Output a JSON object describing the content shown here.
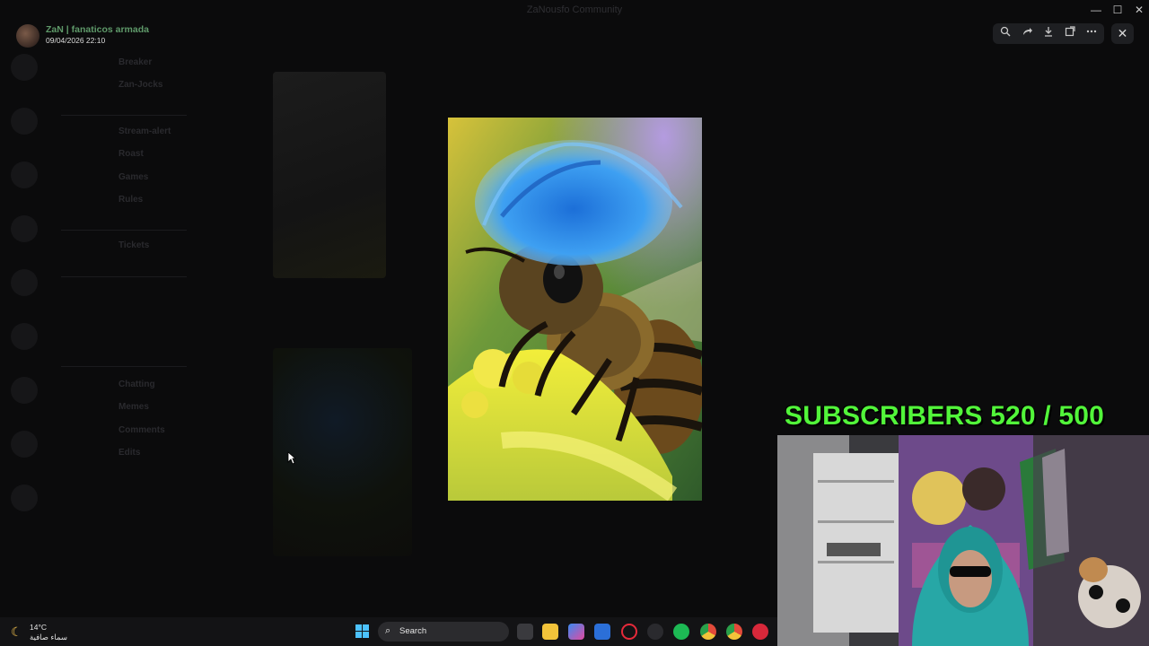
{
  "window": {
    "title": "ZaNousfo Community",
    "minimize": "—",
    "maximize": "☐",
    "close": "✕"
  },
  "uploader": {
    "name": "ZaN | fanaticos armada",
    "datetime": "09/04/2026 22:10"
  },
  "background": {
    "channels": [
      "Breaker",
      "Zan-Jocks",
      "Stream-alert",
      "Roast",
      "Games",
      "Rules",
      "Tickets",
      "Chatting",
      "Memes",
      "Comments",
      "Edits"
    ]
  },
  "viewer": {
    "tools": [
      "zoom-icon",
      "forward-icon",
      "download-icon",
      "open-external-icon",
      "more-icon"
    ],
    "close_label": "✕",
    "image_alt": "Bee with blue hair on a yellow flower"
  },
  "overlay": {
    "subscribers_text": "SUBSCRIBERS 520 / 500",
    "accent_color": "#52f53a"
  },
  "taskbar": {
    "weather_temp": "14°C",
    "weather_desc": "سماء صافية",
    "search_placeholder": "Search",
    "apps": [
      "task-view-icon",
      "file-explorer-icon",
      "copilot-icon",
      "store-icon",
      "opera-icon",
      "obs-icon",
      "spotify-icon",
      "chrome-icon",
      "chrome-profile-icon",
      "app-icon"
    ]
  }
}
